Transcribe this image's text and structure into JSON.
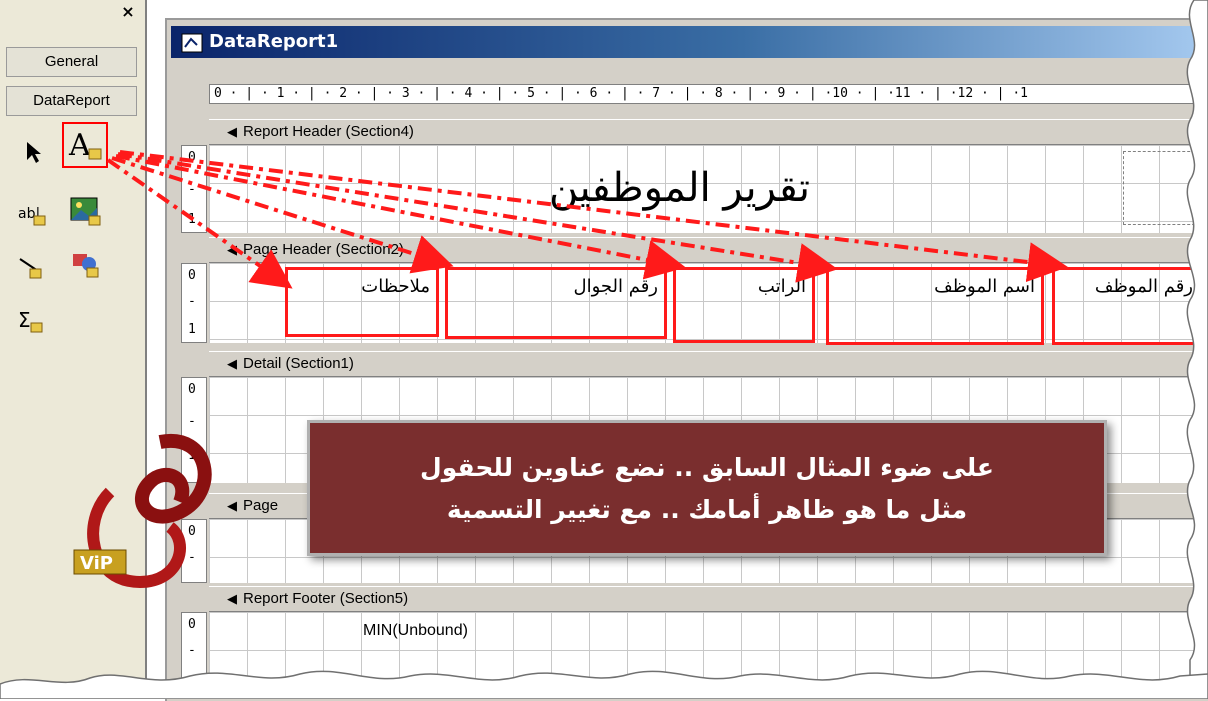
{
  "toolbox": {
    "close_label": "×",
    "tabs": [
      "General",
      "DataReport"
    ],
    "tools": [
      "pointer-icon",
      "rptlabel-icon",
      "rpttextbox-icon",
      "rptimage-icon",
      "rptline-icon",
      "rptshape-icon",
      "rptfunction-icon"
    ]
  },
  "window": {
    "title": "DataReport1"
  },
  "ruler": {
    "text": "0 · | · 1 · | · 2 · | · 3 · | · 4 · | · 5 · | · 6 · | · 7 · | · 8 · | · 9 · | ·10 · | ·11 · | ·12 · | ·1"
  },
  "sections": {
    "report_header": "Report Header (Section4)",
    "page_header": "Page Header (Section2)",
    "detail": "Detail (Section1)",
    "page_footer": "Page",
    "report_footer": "Report Footer (Section5)"
  },
  "report_title": "تقرير الموظفين",
  "page_header_labels": [
    "ملاحظات",
    "رقم الجوال",
    "الراتب",
    "اسم الموظف",
    "رقم الموظف"
  ],
  "footer_field": "MIN(Unbound)",
  "callout": {
    "line1": "على ضوء المثال السابق .. نضع عناوين للحقول",
    "line2": "مثل ما هو ظاهر أمامك .. مع تغيير التسمية"
  },
  "logo_text": "ViP",
  "colors": {
    "annotation_red": "#ff1a1a",
    "callout_bg": "#7a2e2e",
    "titlebar": "#0a246a"
  }
}
